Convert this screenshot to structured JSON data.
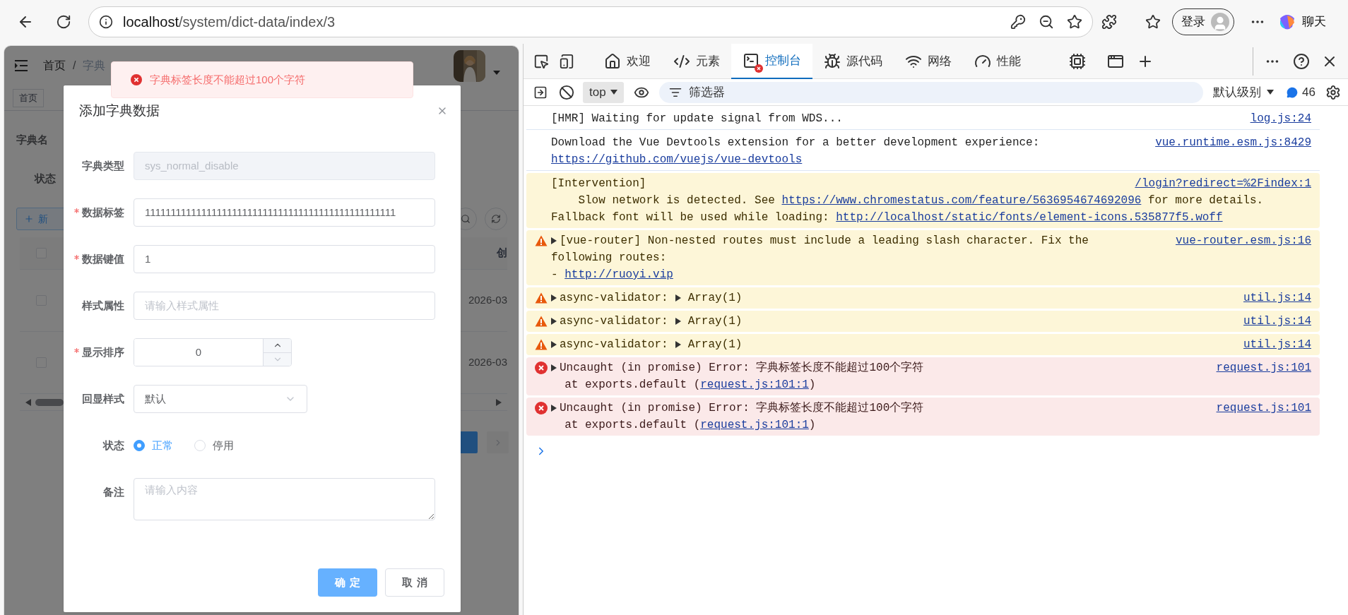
{
  "browser": {
    "url_host": "localhost",
    "url_path": "/system/dict-data/index/3",
    "profile_label": "登录",
    "chat_label": "聊天"
  },
  "page": {
    "breadcrumb": [
      "首页",
      "字典"
    ],
    "breadcrumb_separator": "/",
    "tag": "首页",
    "query_labels": [
      "字典名",
      "状态"
    ],
    "add_button": "新",
    "table_header": "创",
    "header_checked": false,
    "rows": [
      {
        "date": "2026-03",
        "checked": false
      },
      {
        "date": "2026-03",
        "checked": false
      }
    ]
  },
  "toast": {
    "kind": "error",
    "message": "字典标签长度不能超过100个字符"
  },
  "dialog": {
    "title": "添加字典数据",
    "fields": [
      {
        "kind": "input",
        "label": "字典类型",
        "required": false,
        "disabled": true,
        "value": "sys_normal_disable"
      },
      {
        "kind": "input",
        "label": "数据标签",
        "required": true,
        "disabled": false,
        "value": "1111111111111111111111111111111111111111111111111"
      },
      {
        "kind": "input",
        "label": "数据键值",
        "required": true,
        "disabled": false,
        "value": "1"
      },
      {
        "kind": "input",
        "label": "样式属性",
        "required": false,
        "disabled": false,
        "placeholder": "请输入样式属性"
      },
      {
        "kind": "number",
        "label": "显示排序",
        "required": true,
        "value": "0"
      },
      {
        "kind": "select",
        "label": "回显样式",
        "required": false,
        "value": "默认"
      },
      {
        "kind": "radio",
        "label": "状态",
        "required": false,
        "options": [
          {
            "label": "正常",
            "selected": true
          },
          {
            "label": "停用",
            "selected": false
          }
        ]
      },
      {
        "kind": "textarea",
        "label": "备注",
        "required": false,
        "placeholder": "请输入内容"
      }
    ],
    "buttons": [
      {
        "label": "确定",
        "kind": "primary"
      },
      {
        "label": "取消",
        "kind": "default"
      }
    ]
  },
  "devtools": {
    "tabs": [
      {
        "label": "欢迎",
        "selected": false,
        "error_badge": false
      },
      {
        "label": "元素",
        "selected": false,
        "error_badge": false
      },
      {
        "label": "控制台",
        "selected": true,
        "error_badge": true
      },
      {
        "label": "源代码",
        "selected": false,
        "error_badge": false
      },
      {
        "label": "网络",
        "selected": false,
        "error_badge": false
      },
      {
        "label": "性能",
        "selected": false,
        "error_badge": false
      }
    ],
    "toolbar": {
      "context": "top",
      "filter_placeholder": "筛选器",
      "level": "默认级别",
      "message_count": "46"
    },
    "messages": [
      {
        "kind": "log",
        "expandable": false,
        "source": "log.js:24",
        "lines": [
          [
            {
              "kind": "text",
              "text": "[HMR] Waiting for update signal from WDS..."
            }
          ]
        ]
      },
      {
        "kind": "log",
        "expandable": false,
        "source": "vue.runtime.esm.js:8429",
        "lines": [
          [
            {
              "kind": "text",
              "text": "Download the Vue Devtools extension for a better development experience:"
            }
          ],
          [
            {
              "kind": "link",
              "text": "https://github.com/vuejs/vue-devtools"
            }
          ]
        ]
      },
      {
        "kind": "intervention",
        "expandable": false,
        "source": "/login?redirect=%2Findex:1",
        "lines": [
          [
            {
              "kind": "text",
              "text": "[Intervention]"
            }
          ],
          [
            {
              "kind": "text",
              "text": "    Slow network is detected. See "
            },
            {
              "kind": "link",
              "text": "https://www.chromestatus.com/feature/5636954674692096"
            },
            {
              "kind": "text",
              "text": " for more details."
            }
          ],
          [
            {
              "kind": "text",
              "text": "Fallback font will be used while loading: "
            },
            {
              "kind": "link",
              "text": "http://localhost/static/fonts/element-icons.535877f5.woff"
            }
          ]
        ]
      },
      {
        "kind": "warning",
        "expandable": true,
        "source": "vue-router.esm.js:16",
        "lines": [
          [
            {
              "kind": "text",
              "text": "[vue-router] Non-nested routes must include a leading slash character. Fix the"
            }
          ],
          [
            {
              "kind": "text",
              "text": "following routes:"
            }
          ],
          [
            {
              "kind": "text",
              "text": "- "
            },
            {
              "kind": "link",
              "text": "http://ruoyi.vip"
            }
          ]
        ]
      },
      {
        "kind": "warning",
        "expandable": true,
        "source": "util.js:14",
        "lines": [
          [
            {
              "kind": "text",
              "text": "async-validator:"
            },
            {
              "kind": "expander"
            },
            {
              "kind": "text",
              "text": "Array(1)"
            }
          ]
        ]
      },
      {
        "kind": "warning",
        "expandable": true,
        "source": "util.js:14",
        "lines": [
          [
            {
              "kind": "text",
              "text": "async-validator:"
            },
            {
              "kind": "expander"
            },
            {
              "kind": "text",
              "text": "Array(1)"
            }
          ]
        ]
      },
      {
        "kind": "warning",
        "expandable": true,
        "source": "util.js:14",
        "lines": [
          [
            {
              "kind": "text",
              "text": "async-validator:"
            },
            {
              "kind": "expander"
            },
            {
              "kind": "text",
              "text": "Array(1)"
            }
          ]
        ]
      },
      {
        "kind": "error",
        "expandable": true,
        "source": "request.js:101",
        "lines": [
          [
            {
              "kind": "text",
              "text": "Uncaught (in promise) Error: 字典标签长度不能超过100个字符"
            }
          ],
          [
            {
              "kind": "text",
              "text": "  at exports.default ("
            },
            {
              "kind": "link",
              "text": "request.js:101:1"
            },
            {
              "kind": "text",
              "text": ")"
            }
          ]
        ]
      },
      {
        "kind": "error",
        "expandable": true,
        "source": "request.js:101",
        "lines": [
          [
            {
              "kind": "text",
              "text": "Uncaught (in promise) Error: 字典标签长度不能超过100个字符"
            }
          ],
          [
            {
              "kind": "text",
              "text": "  at exports.default ("
            },
            {
              "kind": "link",
              "text": "request.js:101:1"
            },
            {
              "kind": "text",
              "text": ")"
            }
          ]
        ]
      }
    ]
  }
}
